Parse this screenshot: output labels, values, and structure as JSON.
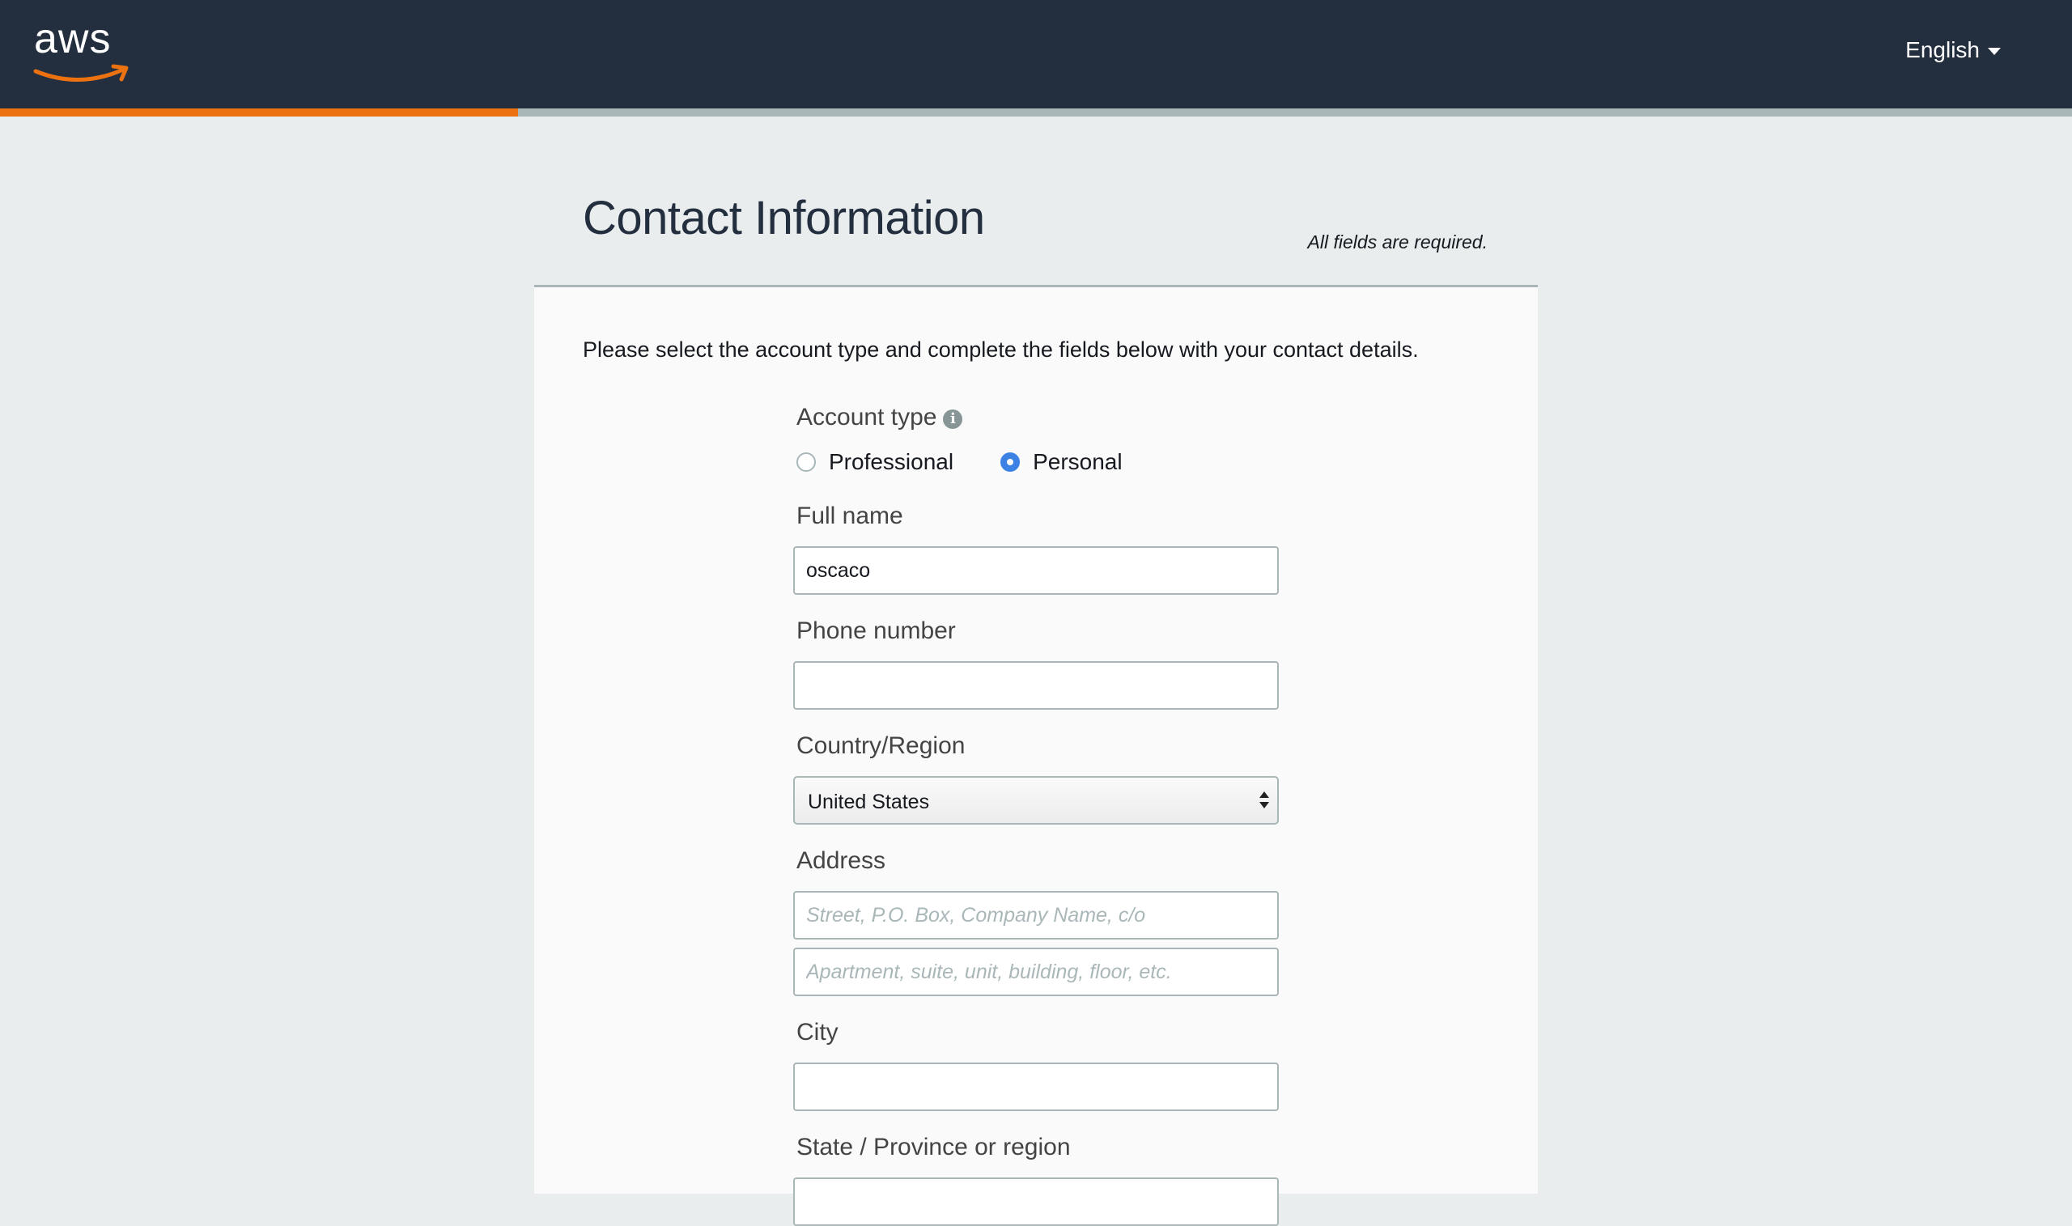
{
  "header": {
    "logo_text": "aws",
    "language": "English",
    "progress_fraction": 0.25
  },
  "page": {
    "title": "Contact Information",
    "required_note": "All fields are required.",
    "intro": "Please select the account type and complete the fields below with your contact details."
  },
  "form": {
    "account_type": {
      "label": "Account type",
      "options": [
        "Professional",
        "Personal"
      ],
      "selected": "Personal"
    },
    "full_name": {
      "label": "Full name",
      "value": "oscaco"
    },
    "phone": {
      "label": "Phone number",
      "value": ""
    },
    "country": {
      "label": "Country/Region",
      "value": "United States"
    },
    "address": {
      "label": "Address",
      "line1_placeholder": "Street, P.O. Box, Company Name, c/o",
      "line2_placeholder": "Apartment, suite, unit, building, floor, etc."
    },
    "city": {
      "label": "City",
      "value": ""
    },
    "state": {
      "label": "State / Province or region",
      "value": ""
    }
  },
  "colors": {
    "header_bg": "#232f3e",
    "progress_fill": "#ec7211",
    "progress_track": "#aab7b8",
    "page_bg": "#e9edee",
    "radio_selected": "#3b82e4"
  }
}
